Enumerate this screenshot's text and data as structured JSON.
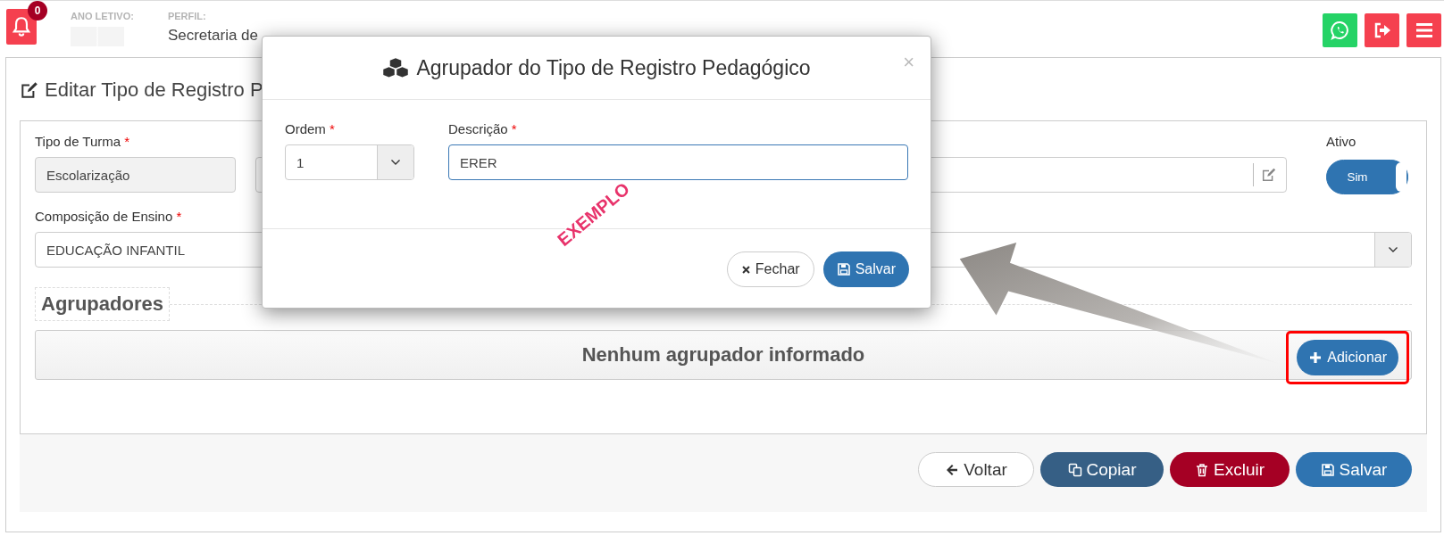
{
  "header": {
    "notification_count": "0",
    "year_label": "ANO LETIVO:",
    "profile_label": "PERFIL:",
    "profile_value": "Secretaria de"
  },
  "header_buttons": [
    {
      "kind": "whatsapp"
    },
    {
      "kind": "logout"
    },
    {
      "kind": "menu"
    }
  ],
  "page": {
    "title": "Editar Tipo de Registro P",
    "tipo_turma": {
      "label": "Tipo de Turma",
      "required_mark": "*",
      "value": "Escolarização",
      "disabled": true
    },
    "ativo": {
      "label": "Ativo",
      "text": "Sim",
      "on": true
    },
    "composicao": {
      "label": "Composição de Ensino",
      "required_mark": "*",
      "value": "EDUCAÇÃO INFANTIL"
    },
    "section": {
      "title": "Agrupadores",
      "empty_message": "Nenhum agrupador informado",
      "add_button": "Adicionar",
      "highlighted": true
    },
    "buttons": [
      {
        "kind": "back",
        "label": "Voltar"
      },
      {
        "kind": "copy",
        "label": "Copiar"
      },
      {
        "kind": "delete",
        "label": "Excluir"
      },
      {
        "kind": "save",
        "label": "Salvar"
      }
    ]
  },
  "modal": {
    "title": "Agrupador do Tipo de Registro Pedagógico",
    "close": "×",
    "ordem": {
      "label": "Ordem",
      "required_mark": "*",
      "value": "1"
    },
    "descricao": {
      "label": "Descrição",
      "required_mark": "*",
      "value": "ERER",
      "focused": true
    },
    "buttons": [
      {
        "kind": "close",
        "label": "Fechar"
      },
      {
        "kind": "save",
        "label": "Salvar"
      }
    ]
  },
  "annotation": {
    "stamp": "EXEMPLO"
  }
}
